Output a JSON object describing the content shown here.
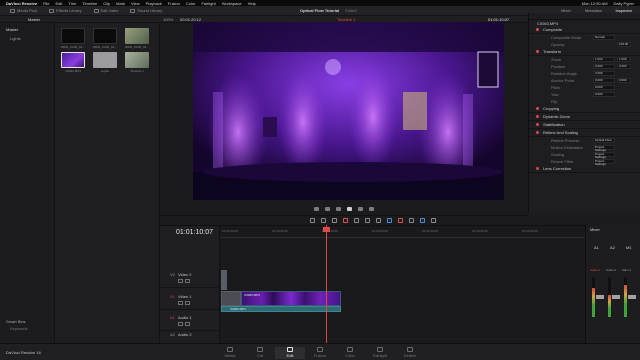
{
  "macbar": {
    "app": "DaVinci Resolve",
    "menus": [
      "File",
      "Edit",
      "Trim",
      "Timeline",
      "Clip",
      "Mark",
      "View",
      "Playback",
      "Fusion",
      "Color",
      "Fairlight",
      "Workspace",
      "Help"
    ],
    "clock": "Mon 12:50 AM",
    "user": "Daily Pyper"
  },
  "toolbar": {
    "items": [
      "Media Pool",
      "Effects Library",
      "Edit Index",
      "Sound Library"
    ],
    "project_title": "Optical Flow Tutorial",
    "project_status": "Edited",
    "right_items": [
      "Mixer",
      "Metadata",
      "Inspector"
    ]
  },
  "subbar": {
    "bin": "Master",
    "zoom": "100%",
    "timecode_left": "00:01:20:12",
    "timeline_name": "Timeline 1",
    "timecode_right": "01:01:10:07",
    "clip_name": "C0063.MP4"
  },
  "mediapool": {
    "tree_root": "Master",
    "tree_items": [
      "Lights"
    ],
    "clips": [
      {
        "label": "B001_C002_04...",
        "color": "#0a0a0a"
      },
      {
        "label": "B001_C003_04...",
        "color": "#0a0a0a"
      },
      {
        "label": "B001_C004_04...",
        "color": "#7a8a6a"
      },
      {
        "label": "C0063.MP4",
        "color": "#6a2fc0"
      },
      {
        "label": "Lights",
        "color": "#9c9c9e"
      },
      {
        "label": "Timeline 1",
        "color": "#7d8b78"
      }
    ],
    "smart_bins_title": "Smart Bins",
    "smart_bins": [
      "Keywords"
    ]
  },
  "timeline": {
    "timecode": "01:01:10:07",
    "ruler_marks": [
      "01:00:00:00",
      "01:00:40:00",
      "01:01:20:00",
      "01:02:00:00",
      "01:02:40:00",
      "01:03:20:00",
      "01:04:00:00"
    ],
    "tracks": [
      {
        "id": "V2",
        "name": "Video 2"
      },
      {
        "id": "V1",
        "name": "Video 1"
      },
      {
        "id": "A1",
        "name": "Audio 1"
      },
      {
        "id": "A2",
        "name": "Audio 2"
      }
    ],
    "clip_video_label": "C0063.MP4",
    "clip_audio_label": "C0063.MP4"
  },
  "inspector": {
    "file": "C0063.MP4",
    "sections": {
      "composite": "Composite",
      "transform": "Transform",
      "cropping": "Cropping",
      "dynamic_zoom": "Dynamic Zoom",
      "stabilization": "Stabilization",
      "retime": "Retime And Scaling",
      "lens": "Lens Correction"
    },
    "composite_props": [
      {
        "label": "Composite Mode",
        "value": "Normal"
      },
      {
        "label": "Opacity",
        "value": "100.00"
      }
    ],
    "transform_props": [
      {
        "label": "Zoom",
        "x": "1.000",
        "y": "1.000"
      },
      {
        "label": "Position",
        "x": "0.000",
        "y": "0.000"
      },
      {
        "label": "Rotation Angle",
        "x": "0.000",
        "y": ""
      },
      {
        "label": "Anchor Point",
        "x": "0.000",
        "y": "0.000"
      },
      {
        "label": "Pitch",
        "x": "0.000",
        "y": ""
      },
      {
        "label": "Yaw",
        "x": "0.000",
        "y": ""
      },
      {
        "label": "Flip",
        "x": "",
        "y": ""
      }
    ],
    "retime_props": [
      {
        "label": "Retime Process",
        "value": "Optical Flow"
      },
      {
        "label": "Motion Estimation",
        "value": "Project Settings"
      },
      {
        "label": "Scaling",
        "value": "Project Settings"
      },
      {
        "label": "Resize Filter",
        "value": "Project Settings"
      }
    ]
  },
  "mixer": {
    "title": "Mixer",
    "channels": [
      "A1",
      "A2",
      "M1"
    ],
    "labels": [
      "Audio 1",
      "Audio 2",
      "Main 1"
    ],
    "levels": [
      0.72,
      0.55,
      0.8
    ]
  },
  "pages": {
    "brand": "DaVinci Resolve 16",
    "items": [
      {
        "label": "Media",
        "active": false
      },
      {
        "label": "Cut",
        "active": false
      },
      {
        "label": "Edit",
        "active": true
      },
      {
        "label": "Fusion",
        "active": false
      },
      {
        "label": "Color",
        "active": false
      },
      {
        "label": "Fairlight",
        "active": false
      },
      {
        "label": "Deliver",
        "active": false
      }
    ]
  }
}
